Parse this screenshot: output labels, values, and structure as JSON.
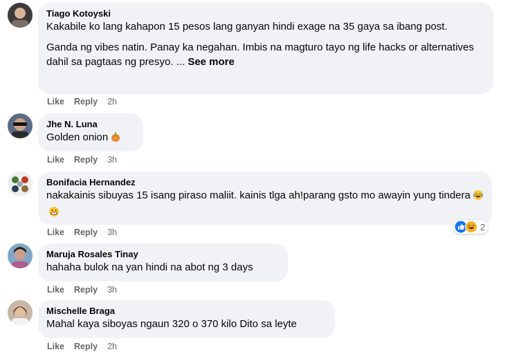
{
  "comments": [
    {
      "author": "Tiago Kotoyski",
      "paragraphs": [
        "Kakabile ko lang kahapon 15 pesos lang ganyan hindi exage na 35 gaya sa ibang post.",
        "Ganda ng vibes natin. Panay ka negahan. Imbis na magturo tayo ng life hacks or alternatives dahil sa pagtaas ng presyo. ..."
      ],
      "see_more": "See more",
      "like": "Like",
      "reply": "Reply",
      "time": "2h"
    },
    {
      "author": "Jhe N. Luna",
      "text": "Golden onion",
      "emoji": "onion-emoji",
      "like": "Like",
      "reply": "Reply",
      "time": "3h"
    },
    {
      "author": "Bonifacia Hernandez",
      "text": "nakakainis sibuyas 15 isang piraso maliit. kainis tlga ah!parang gsto mo awayin yung tindera",
      "emoji": [
        "laughing-tears-emoji",
        "grimace-emoji"
      ],
      "reactions": {
        "icons": [
          "like-reaction-icon",
          "haha-reaction-icon"
        ],
        "count": "2"
      },
      "like": "Like",
      "reply": "Reply",
      "time": "3h"
    },
    {
      "author": "Maruja Rosales Tinay",
      "text": "hahaha bulok na yan hindi na abot ng 3 days",
      "like": "Like",
      "reply": "Reply",
      "time": "3h"
    },
    {
      "author": "Mischelle Braga",
      "text": "Mahal kaya siboyas ngaun 320 o 370 kilo Dito sa leyte",
      "like": "Like",
      "reply": "Reply",
      "time": "2h"
    }
  ],
  "colors": {
    "bubble": "#f0f2f5",
    "text": "#050505",
    "meta": "#65676b",
    "like_reaction": "#1877f2",
    "haha_reaction": "#f7b125"
  }
}
